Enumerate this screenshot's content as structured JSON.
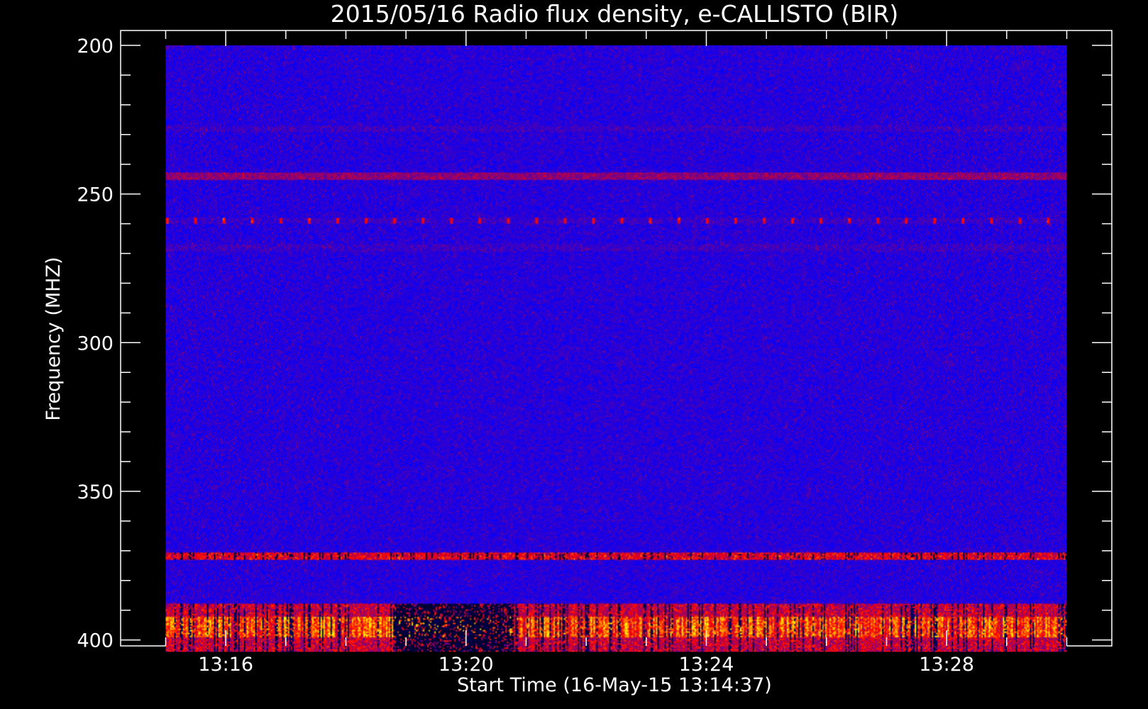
{
  "chart_data": {
    "type": "heatmap",
    "title": "2015/05/16  Radio flux density, e-CALLISTO (BIR)",
    "xlabel": "Start Time (16-May-15 13:14:37)",
    "ylabel": "Frequency (MHZ)",
    "x_start": "13:15:00",
    "x_end": "13:30:00",
    "x_unit": "time",
    "xlim": [
      "13:14:15",
      "13:30:45"
    ],
    "x_ticks": [
      {
        "value": "13:16",
        "minutes": 16
      },
      {
        "value": "13:20",
        "minutes": 20
      },
      {
        "value": "13:24",
        "minutes": 24
      },
      {
        "value": "13:28",
        "minutes": 28
      }
    ],
    "ylim": [
      195,
      402
    ],
    "y_inverted": true,
    "y_data_range": [
      200,
      404
    ],
    "y_ticks": [
      {
        "value": "200",
        "mhz": 200
      },
      {
        "value": "250",
        "mhz": 250
      },
      {
        "value": "300",
        "mhz": 300
      },
      {
        "value": "350",
        "mhz": 350
      },
      {
        "value": "400",
        "mhz": 400
      }
    ],
    "colormap": [
      "#000000",
      "#0000ff",
      "#ff0000",
      "#ffff00"
    ],
    "background_color": "#1c14e0",
    "features": [
      {
        "kind": "band",
        "frequency_mhz": 244,
        "intensity": "moderate"
      },
      {
        "kind": "dotted",
        "frequency_mhz": 259,
        "intensity": "moderate"
      },
      {
        "kind": "faint",
        "frequency_mhz": 268,
        "intensity": "weak"
      },
      {
        "kind": "faint",
        "frequency_mhz": 228,
        "intensity": "weak"
      },
      {
        "kind": "band",
        "frequency_mhz": 372,
        "intensity": "strong"
      },
      {
        "kind": "burst",
        "frequency_mhz": [
          388,
          404
        ],
        "intensity": "strong"
      }
    ],
    "grid": false,
    "legend": "none"
  }
}
